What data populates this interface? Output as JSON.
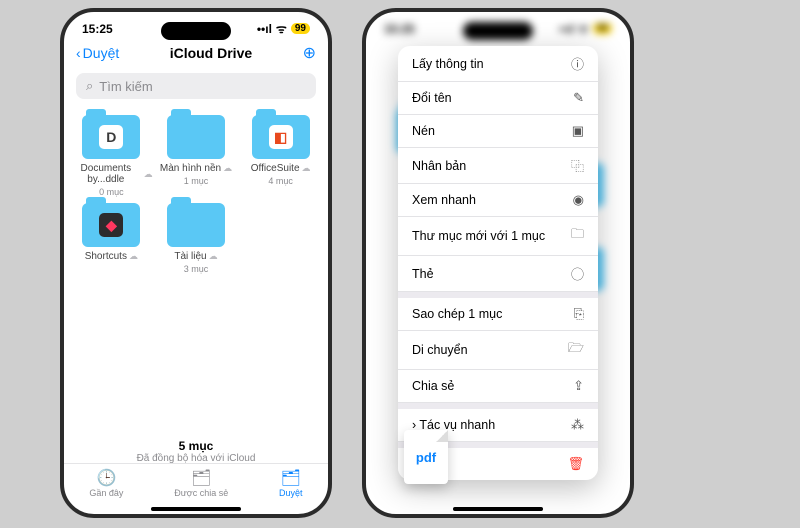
{
  "status": {
    "time": "15:25",
    "signal": "••ıl",
    "wifi": "ᯤ",
    "battery": "99"
  },
  "left": {
    "back": "Duyệt",
    "title": "iCloud Drive",
    "search_placeholder": "Tìm kiếm",
    "items": [
      {
        "name": "Documents by...ddle",
        "count": "0 mục",
        "app": "D",
        "appbg": "#fff",
        "appfg": "#3a3a3a"
      },
      {
        "name": "Màn hình nền",
        "count": "1 mục",
        "app": "",
        "appbg": "transparent"
      },
      {
        "name": "OfficeSuite",
        "count": "4 mục",
        "app": "◧",
        "appbg": "#fff",
        "appfg": "#e8491e"
      },
      {
        "name": "Shortcuts",
        "count": "",
        "app": "◆",
        "appbg": "#2c2c2e",
        "appfg": "#ff375f"
      },
      {
        "name": "Tài liệu",
        "count": "3 mục",
        "app": "",
        "appbg": "transparent"
      }
    ],
    "footer_count": "5 mục",
    "footer_sync": "Đã đồng bộ hóa với iCloud",
    "tabs": [
      {
        "label": "Gần đây",
        "icon": "🕒"
      },
      {
        "label": "Được chia sẻ",
        "icon": "🗂"
      },
      {
        "label": "Duyệt",
        "icon": "🗂"
      }
    ]
  },
  "menu": [
    {
      "label": "Lấy thông tin",
      "icon": "ⓘ"
    },
    {
      "label": "Đổi tên",
      "icon": "✎"
    },
    {
      "label": "Nén",
      "icon": "▣"
    },
    {
      "label": "Nhân bản",
      "icon": "⿻"
    },
    {
      "label": "Xem nhanh",
      "icon": "◉"
    },
    {
      "label": "Thư mục mới với 1 mục",
      "icon": "🗀"
    },
    {
      "label": "Thẻ",
      "icon": "⃝"
    },
    {
      "label": "Sao chép 1 mục",
      "icon": "⎘",
      "sep": true
    },
    {
      "label": "Di chuyển",
      "icon": "🗁"
    },
    {
      "label": "Chia sẻ",
      "icon": "⇪"
    },
    {
      "label": "Tác vụ nhanh",
      "icon": "⁂",
      "sep": true,
      "prefix": "›"
    },
    {
      "label": "Xóa",
      "icon": "🗑",
      "sep": true,
      "danger": true
    }
  ],
  "pdf_label": "pdf"
}
